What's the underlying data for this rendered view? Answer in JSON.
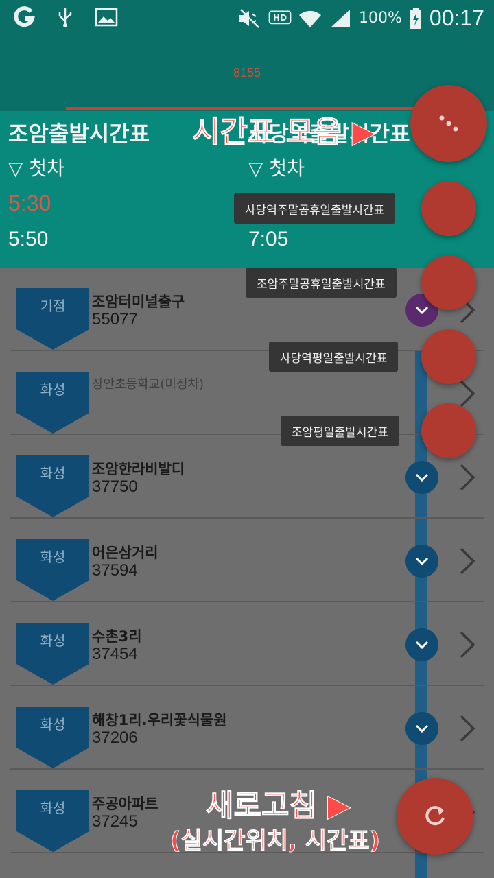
{
  "status_bar": {
    "battery": "100%",
    "time": "00:17",
    "icons": [
      "g-app-icon",
      "usb-icon",
      "image-icon",
      "mute-icon",
      "hd-icon",
      "wifi-icon",
      "signal-icon",
      "battery-icon"
    ]
  },
  "header": {
    "route_number": "8155"
  },
  "timetable": {
    "left": {
      "title": "조암출발시간표",
      "first_label": "▽ 첫차",
      "time1": "5:30",
      "time2": "5:50"
    },
    "right": {
      "title": "사당역출발시간표",
      "first_label": "▽ 첫차",
      "time2": "7:05"
    }
  },
  "annotations": {
    "top": "시간표 모음 ▶",
    "bottom_line1": "새로고침 ▶",
    "bottom_line2": "(실시간위치, 시간표)"
  },
  "fab_menu": {
    "items": [
      {
        "label": "사당역주말공휴일출발시간표"
      },
      {
        "label": "조암주말공휴일출발시간표"
      },
      {
        "label": "사당역평일출발시간표"
      },
      {
        "label": "조암평일출발시간표"
      }
    ]
  },
  "stops": [
    {
      "badge": "기점",
      "name": "조암터미널출구",
      "id": "55077"
    },
    {
      "badge": "화성",
      "name": "장안초등학교(미정차)",
      "id": ""
    },
    {
      "badge": "화성",
      "name": "조암한라비발디",
      "id": "37750"
    },
    {
      "badge": "화성",
      "name": "어은삼거리",
      "id": "37594"
    },
    {
      "badge": "화성",
      "name": "수촌3리",
      "id": "37454"
    },
    {
      "badge": "화성",
      "name": "해창1리.우리꽃식물원",
      "id": "37206"
    },
    {
      "badge": "화성",
      "name": "주공아파트",
      "id": "37245"
    }
  ],
  "colors": {
    "teal": "#0a6f66",
    "panel": "#08897c",
    "fab": "#b03a30",
    "accent_red": "#e0574a",
    "badge": "#0f4b73"
  }
}
